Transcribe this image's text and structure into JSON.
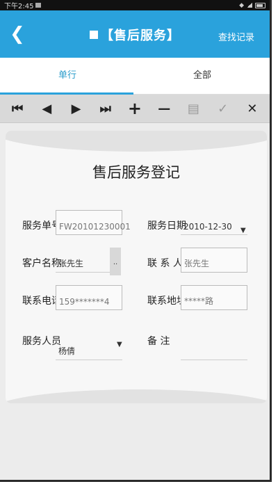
{
  "status": {
    "time": "下午2:45"
  },
  "header": {
    "title": "【售后服务】",
    "action": "查找记录"
  },
  "tabs": [
    {
      "label": "单行"
    },
    {
      "label": "全部"
    }
  ],
  "toolbar": {
    "first": "⏮",
    "prev": "◀",
    "next": "▶",
    "last": "⏭",
    "add": "+",
    "delete": "—",
    "save": "▤",
    "confirm": "✓",
    "cancel": "✕"
  },
  "form": {
    "title": "售后服务登记",
    "fields": {
      "service_no": {
        "label": "服务单号",
        "value": "FW20101230001"
      },
      "service_date": {
        "label": "服务日期",
        "value": "2010-12-30"
      },
      "customer_name": {
        "label": "客户名称",
        "value": "张先生"
      },
      "contact": {
        "label": "联 系 人",
        "value": "张先生"
      },
      "phone": {
        "label": "联系电话",
        "value": "159*******4"
      },
      "address": {
        "label": "联系地址",
        "value": "*****路"
      },
      "staff": {
        "label": "服务人员",
        "value": "杨倩"
      },
      "remark": {
        "label": "备  注",
        "value": ""
      }
    },
    "ellipsis": "..",
    "dropdown_arrow": "▼"
  }
}
